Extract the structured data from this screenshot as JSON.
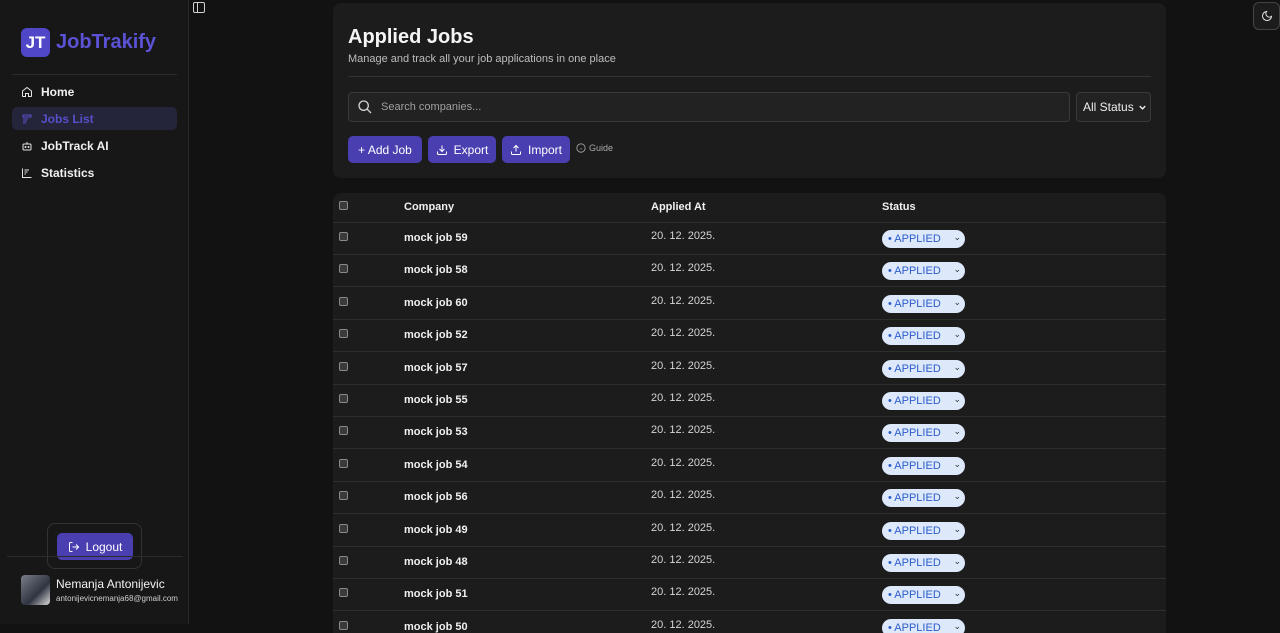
{
  "app": {
    "badge": "JT",
    "name": "JobTrakify"
  },
  "nav": [
    {
      "label": "Home",
      "icon": "home-icon",
      "active": false
    },
    {
      "label": "Jobs List",
      "icon": "list-icon",
      "active": true
    },
    {
      "label": "JobTrack AI",
      "icon": "bot-icon",
      "active": false
    },
    {
      "label": "Statistics",
      "icon": "chart-icon",
      "active": false
    }
  ],
  "logout_label": "Logout",
  "user": {
    "name": "Nemanja Antonijevic",
    "email": "antonijevicnemanja68@gmail.com"
  },
  "page": {
    "title": "Applied Jobs",
    "subtitle": "Manage and track all your job applications in one place"
  },
  "search": {
    "placeholder": "Search companies..."
  },
  "status_filter": {
    "selected": "All Status"
  },
  "actions": {
    "add": "+ Add Job",
    "export": "Export",
    "import": "Import",
    "guide": "Guide"
  },
  "table": {
    "headers": {
      "company": "Company",
      "applied_at": "Applied At",
      "status": "Status"
    },
    "rows": [
      {
        "company": "mock job 59",
        "date": "20. 12. 2025.",
        "status": "• APPLIED"
      },
      {
        "company": "mock job 58",
        "date": "20. 12. 2025.",
        "status": "• APPLIED"
      },
      {
        "company": "mock job 60",
        "date": "20. 12. 2025.",
        "status": "• APPLIED"
      },
      {
        "company": "mock job 52",
        "date": "20. 12. 2025.",
        "status": "• APPLIED"
      },
      {
        "company": "mock job 57",
        "date": "20. 12. 2025.",
        "status": "• APPLIED"
      },
      {
        "company": "mock job 55",
        "date": "20. 12. 2025.",
        "status": "• APPLIED"
      },
      {
        "company": "mock job 53",
        "date": "20. 12. 2025.",
        "status": "• APPLIED"
      },
      {
        "company": "mock job 54",
        "date": "20. 12. 2025.",
        "status": "• APPLIED"
      },
      {
        "company": "mock job 56",
        "date": "20. 12. 2025.",
        "status": "• APPLIED"
      },
      {
        "company": "mock job 49",
        "date": "20. 12. 2025.",
        "status": "• APPLIED"
      },
      {
        "company": "mock job 48",
        "date": "20. 12. 2025.",
        "status": "• APPLIED"
      },
      {
        "company": "mock job 51",
        "date": "20. 12. 2025.",
        "status": "• APPLIED"
      },
      {
        "company": "mock job 50",
        "date": "20. 12. 2025.",
        "status": "• APPLIED"
      }
    ]
  }
}
